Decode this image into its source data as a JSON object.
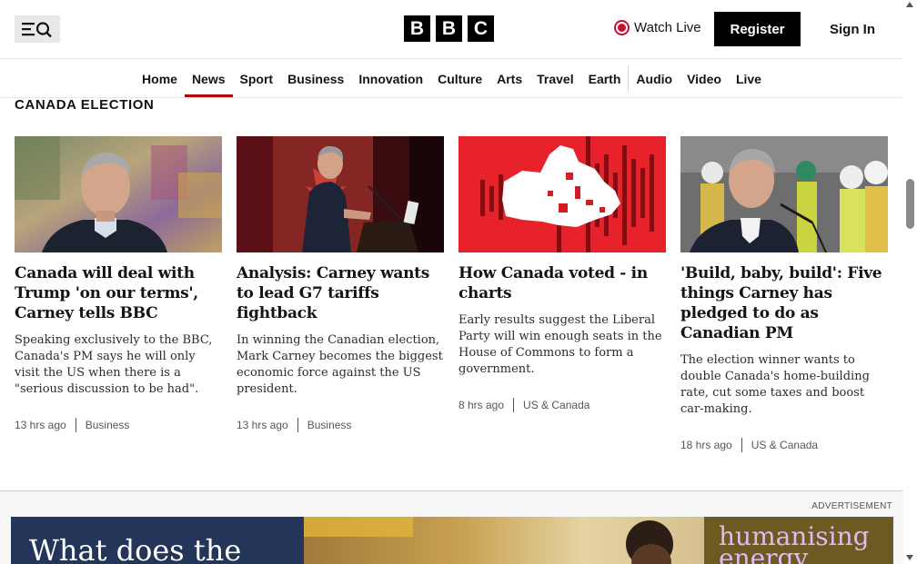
{
  "header": {
    "logo_letters": [
      "B",
      "B",
      "C"
    ],
    "watch_live": "Watch Live",
    "register": "Register",
    "sign_in": "Sign In"
  },
  "nav": {
    "items": [
      "Home",
      "News",
      "Sport",
      "Business",
      "Innovation",
      "Culture",
      "Arts",
      "Travel",
      "Earth",
      "Audio",
      "Video",
      "Live"
    ],
    "active": "News"
  },
  "section": {
    "title": "CANADA ELECTION"
  },
  "cards": [
    {
      "headline": "Canada will deal with Trump 'on our terms', Carney tells BBC",
      "summary": "Speaking exclusively to the BBC, Canada's PM says he will only visit the US when there is a \"serious discussion to be had\".",
      "time": "13 hrs ago",
      "category": "Business"
    },
    {
      "headline": "Analysis: Carney wants to lead G7 tariffs fightback",
      "summary": "In winning the Canadian election, Mark Carney becomes the biggest economic force against the US president.",
      "time": "13 hrs ago",
      "category": "Business"
    },
    {
      "headline": "How Canada voted - in charts",
      "summary": "Early results suggest the Liberal Party will win enough seats in the House of Commons to form a government.",
      "time": "8 hrs ago",
      "category": "US & Canada"
    },
    {
      "headline": "'Build, baby, build': Five things Carney has pledged to do as Canadian PM",
      "summary": "The election winner wants to double Canada's home-building rate, cut some taxes and boost car-making.",
      "time": "18 hrs ago",
      "category": "US & Canada"
    }
  ],
  "advertisement": {
    "label": "ADVERTISEMENT",
    "left_text": "What does the",
    "right_text": "humanising energy"
  },
  "colors": {
    "accent": "#b80000",
    "live_red": "#c8102e",
    "black": "#000000"
  }
}
